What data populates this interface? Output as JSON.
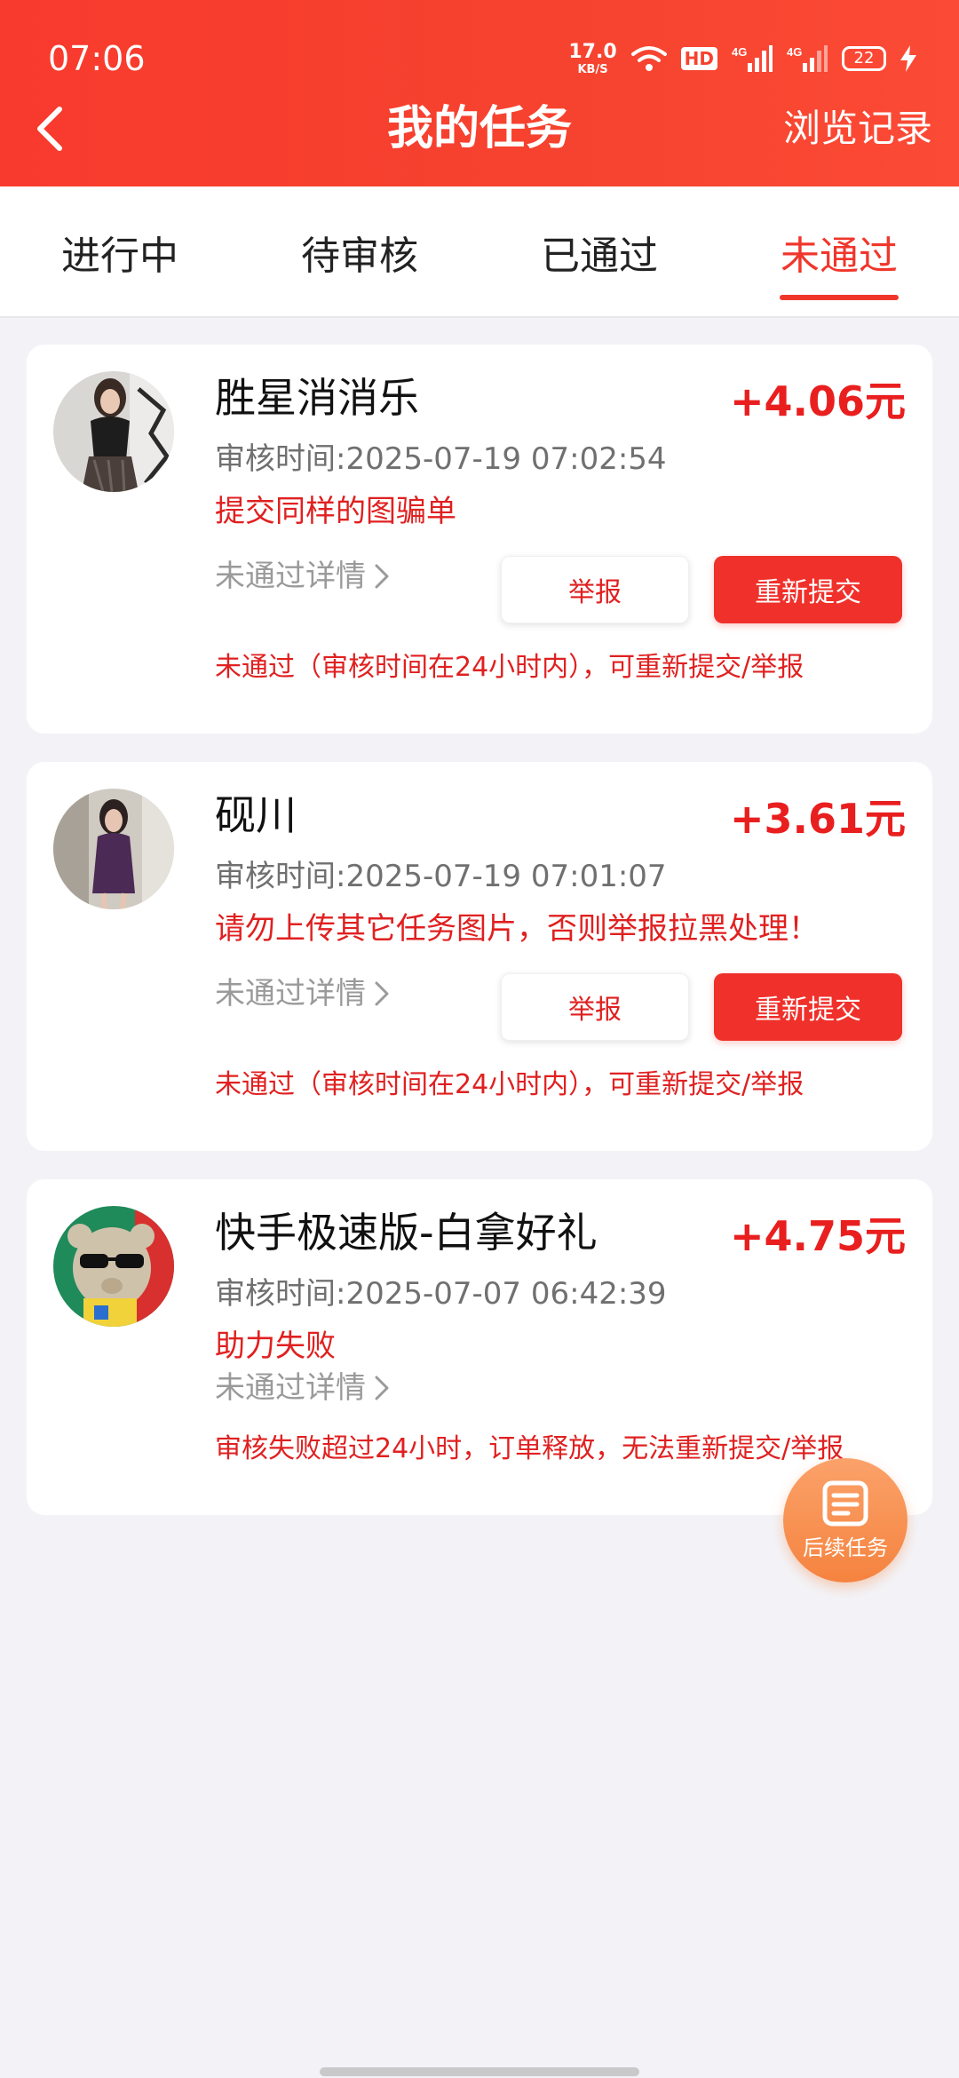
{
  "status_bar": {
    "time": "07:06",
    "net_speed_value": "17.0",
    "net_speed_unit": "KB/S",
    "hd": "HD",
    "signal_1": "4G",
    "signal_2": "4G",
    "battery": "22"
  },
  "header": {
    "title": "我的任务",
    "history": "浏览记录"
  },
  "tabs": [
    {
      "label": "进行中"
    },
    {
      "label": "待审核"
    },
    {
      "label": "已通过"
    },
    {
      "label": "未通过"
    }
  ],
  "active_tab": "未通过",
  "tasks": [
    {
      "title": "胜星消消乐",
      "reward": "+4.06元",
      "review_time": "审核时间:2025-07-19 07:02:54",
      "reason": "提交同样的图骗单",
      "detail": "未通过详情",
      "report": "举报",
      "resubmit": "重新提交",
      "footnote": "未通过（审核时间在24小时内），可重新提交/举报"
    },
    {
      "title": "砚川",
      "reward": "+3.61元",
      "review_time": "审核时间:2025-07-19 07:01:07",
      "reason": "请勿上传其它任务图片，否则举报拉黑处理！",
      "detail": "未通过详情",
      "report": "举报",
      "resubmit": "重新提交",
      "footnote": "未通过（审核时间在24小时内），可重新提交/举报"
    },
    {
      "title": "快手极速版-白拿好礼",
      "reward": "+4.75元",
      "review_time": "审核时间:2025-07-07 06:42:39",
      "reason": "助力失败",
      "detail": "未通过详情",
      "footnote": "审核失败超过24小时，订单释放，无法重新提交/举报"
    }
  ],
  "fab": {
    "label": "后续任务"
  },
  "colors": {
    "header": "#f6432f",
    "accent": "#f0362b",
    "reward": "#e91f1f",
    "fab": "#f5833f"
  }
}
